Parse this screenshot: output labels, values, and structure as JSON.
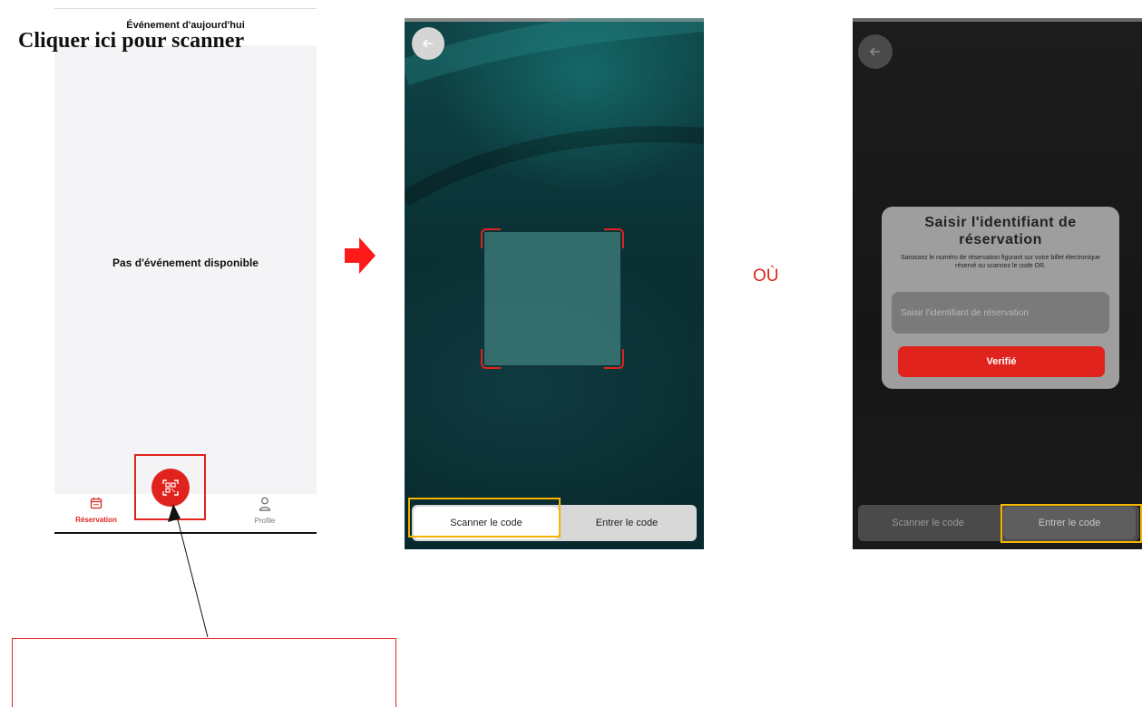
{
  "screen1": {
    "title": "Événement d'aujourd'hui",
    "empty_message": "Pas d'événement disponible",
    "nav": {
      "reservation_label": "Réservation",
      "reservation_icon": "calendar-icon",
      "scan_icon": "qr-scan-icon",
      "profile_label": "Profile",
      "profile_icon": "user-icon"
    }
  },
  "screen2": {
    "back_icon": "arrow-left-icon",
    "tabs": [
      {
        "label": "Scanner le code",
        "active": true
      },
      {
        "label": "Entrer le code",
        "active": false
      }
    ]
  },
  "separator_text": "OÙ",
  "screen3": {
    "back_icon": "arrow-left-icon",
    "modal": {
      "title": "Saisir l'identifiant de réservation",
      "description": "Saisissez le numéro de réservation figurant sur votre billet électronique réservé ou scannez le code OR.",
      "input_placeholder": "Saisir l'identifiant de réservation",
      "input_value": "",
      "verify_label": "Verifié"
    },
    "tabs": [
      {
        "label": "Scanner le code",
        "active": false
      },
      {
        "label": "Entrer le code",
        "active": true
      }
    ]
  },
  "annotation": {
    "callout_text": "Cliquer ici pour scanner"
  },
  "colors": {
    "accent": "#e0231c",
    "highlight": "#f4b400"
  }
}
